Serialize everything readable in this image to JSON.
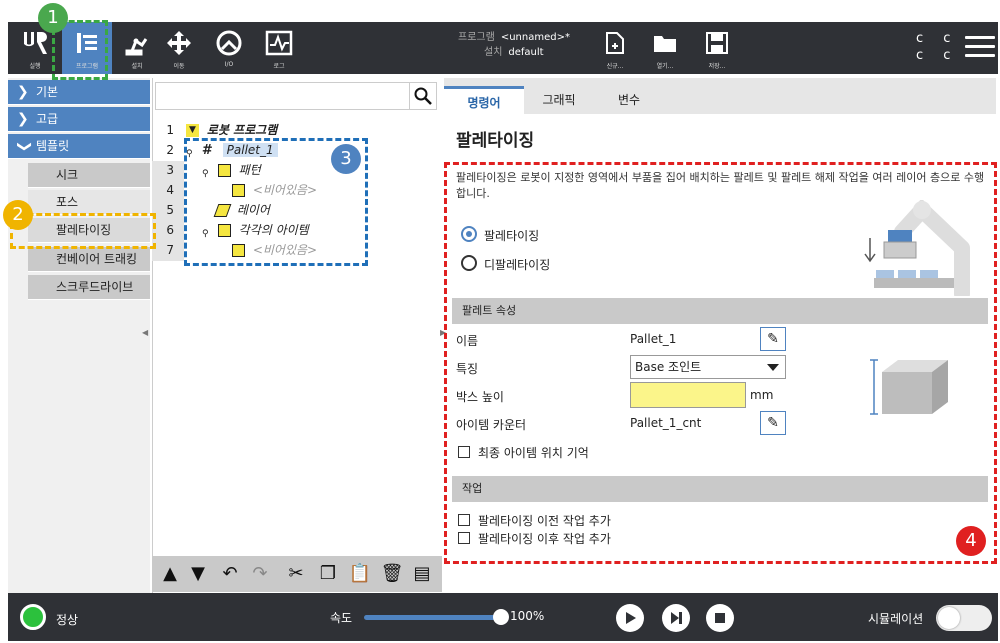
{
  "topbar": {
    "buttons": [
      {
        "label": "실행",
        "icon": "ur-logo-icon"
      },
      {
        "label": "프로그램",
        "icon": "program-icon"
      },
      {
        "label": "설치",
        "icon": "robot-arm-icon"
      },
      {
        "label": "이동",
        "icon": "move-arrows-icon"
      },
      {
        "label": "I/O",
        "icon": "io-icon"
      },
      {
        "label": "로그",
        "icon": "log-icon"
      }
    ],
    "program_label": "프로그램",
    "program_value": "<unnamed>*",
    "install_label": "설치",
    "install_value": "default",
    "file_buttons": [
      {
        "label": "신규...",
        "icon": "new-file-icon"
      },
      {
        "label": "열기...",
        "icon": "open-folder-icon"
      },
      {
        "label": "저장...",
        "icon": "save-icon"
      }
    ],
    "cc_top": "c c",
    "cc_bottom": "c c"
  },
  "left_menu": {
    "sections": [
      "기본",
      "고급",
      "템플릿"
    ],
    "template_items": [
      "시크",
      "포스",
      "팔레타이징",
      "컨베이어 트래킹",
      "스크루드라이브"
    ]
  },
  "tree": {
    "line_numbers": [
      "1",
      "2",
      "3",
      "4",
      "5",
      "6",
      "7"
    ],
    "nodes": [
      "로봇 프로그램",
      "Pallet_1",
      "패턴",
      "<비어있음>",
      "레이어",
      "각각의 아이템",
      "<비어있음>"
    ]
  },
  "tabs": [
    "명령어",
    "그래픽",
    "변수"
  ],
  "main": {
    "title": "팔레타이징",
    "description": "팔레타이징은 로봇이 지정한 영역에서 부품을 집어 배치하는 팔레트 및 팔레트 해제 작업을 여러 레이어 층으로 수행합니다.",
    "radio_palletizing": "팔레타이징",
    "radio_depalletizing": "디팔레타이징",
    "pallet_props_header": "팔레트 속성",
    "name_label": "이름",
    "name_value": "Pallet_1",
    "feature_label": "특징",
    "feature_value": "Base 조인트",
    "box_height_label": "박스 높이",
    "box_height_unit": "mm",
    "item_counter_label": "아이템 카운터",
    "item_counter_value": "Pallet_1_cnt",
    "remember_last_label": "최종 아이템 위치 기억",
    "actions_header": "작업",
    "add_before_label": "팔레타이징 이전 작업 추가",
    "add_after_label": "팔레타이징 이후 작업 추가"
  },
  "badges": [
    "1",
    "2",
    "3",
    "4"
  ],
  "status": {
    "state": "정상",
    "speed_label": "속도",
    "speed_value": "100%",
    "speed_fraction": 1.0,
    "simulation_label": "시뮬레이션"
  },
  "colors": {
    "accent": "#4f83c0",
    "highlight_yellow": "#fbf58a",
    "status_ok": "#2cc13d",
    "annot_green": "#3aa843",
    "annot_yellow": "#f0b400",
    "annot_blue": "#1f6fb8",
    "annot_red": "#e02020"
  }
}
